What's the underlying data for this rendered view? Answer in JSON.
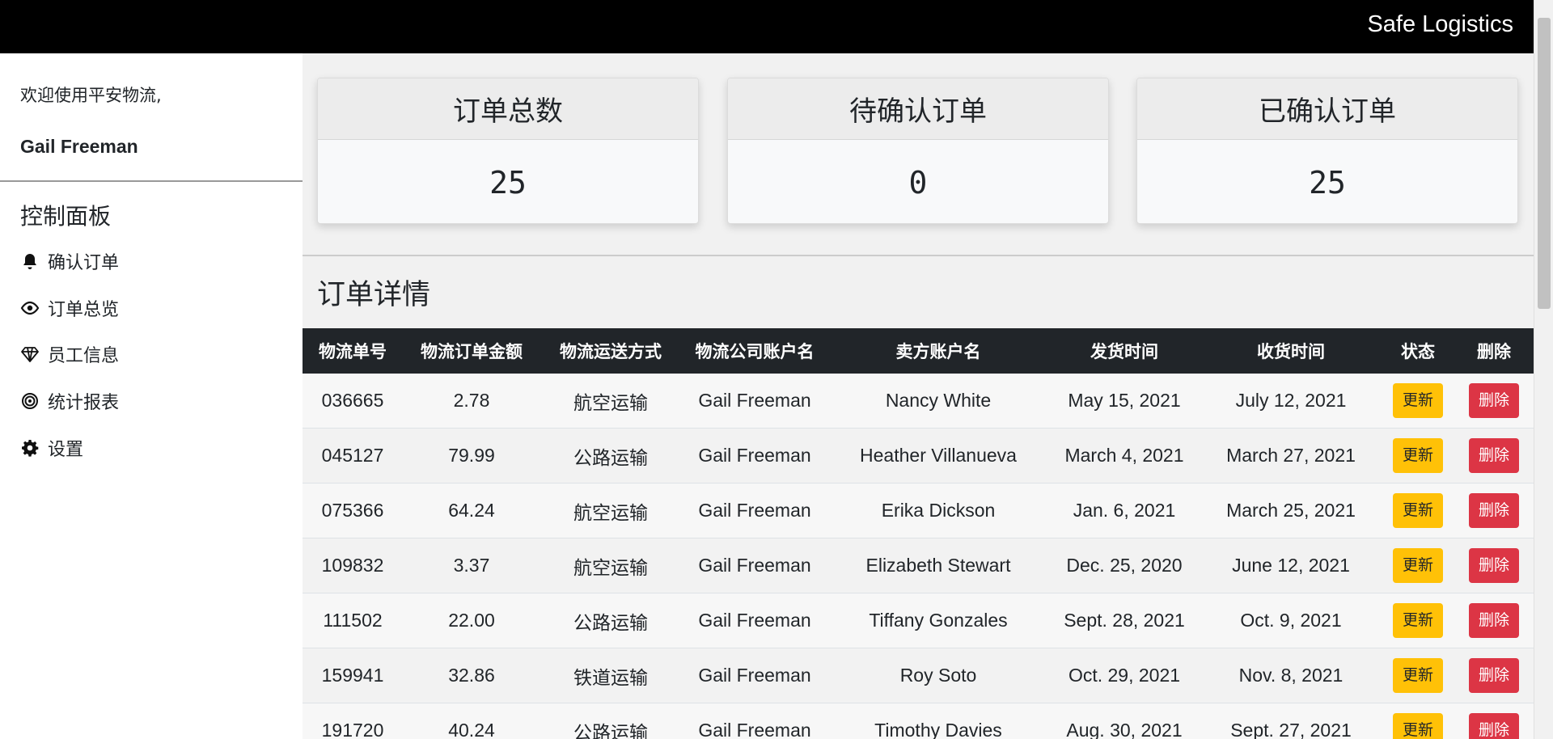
{
  "brand": "Safe Logistics",
  "sidebar": {
    "welcome": "欢迎使用平安物流,",
    "username": "Gail Freeman",
    "panel_title": "控制面板",
    "items": [
      {
        "label": "确认订单",
        "icon": "bell-icon"
      },
      {
        "label": "订单总览",
        "icon": "eye-icon"
      },
      {
        "label": "员工信息",
        "icon": "gem-icon"
      },
      {
        "label": "统计报表",
        "icon": "target-icon"
      },
      {
        "label": "设置",
        "icon": "gear-icon"
      }
    ]
  },
  "cards": [
    {
      "title": "订单总数",
      "value": "25"
    },
    {
      "title": "待确认订单",
      "value": "0"
    },
    {
      "title": "已确认订单",
      "value": "25"
    }
  ],
  "section_title": "订单详情",
  "table": {
    "headers": [
      "物流单号",
      "物流订单金额",
      "物流运送方式",
      "物流公司账户名",
      "卖方账户名",
      "发货时间",
      "收货时间",
      "状态",
      "删除"
    ],
    "update_label": "更新",
    "delete_label": "删除",
    "rows": [
      [
        "036665",
        "2.78",
        "航空运输",
        "Gail Freeman",
        "Nancy White",
        "May 15, 2021",
        "July 12, 2021"
      ],
      [
        "045127",
        "79.99",
        "公路运输",
        "Gail Freeman",
        "Heather Villanueva",
        "March 4, 2021",
        "March 27, 2021"
      ],
      [
        "075366",
        "64.24",
        "航空运输",
        "Gail Freeman",
        "Erika Dickson",
        "Jan. 6, 2021",
        "March 25, 2021"
      ],
      [
        "109832",
        "3.37",
        "航空运输",
        "Gail Freeman",
        "Elizabeth Stewart",
        "Dec. 25, 2020",
        "June 12, 2021"
      ],
      [
        "111502",
        "22.00",
        "公路运输",
        "Gail Freeman",
        "Tiffany Gonzales",
        "Sept. 28, 2021",
        "Oct. 9, 2021"
      ],
      [
        "159941",
        "32.86",
        "铁道运输",
        "Gail Freeman",
        "Roy Soto",
        "Oct. 29, 2021",
        "Nov. 8, 2021"
      ],
      [
        "191720",
        "40.24",
        "公路运输",
        "Gail Freeman",
        "Timothy Davies",
        "Aug. 30, 2021",
        "Sept. 27, 2021"
      ]
    ]
  },
  "colors": {
    "update": "#ffc107",
    "delete": "#dc3545",
    "header": "#212529",
    "topbar": "#000000"
  }
}
